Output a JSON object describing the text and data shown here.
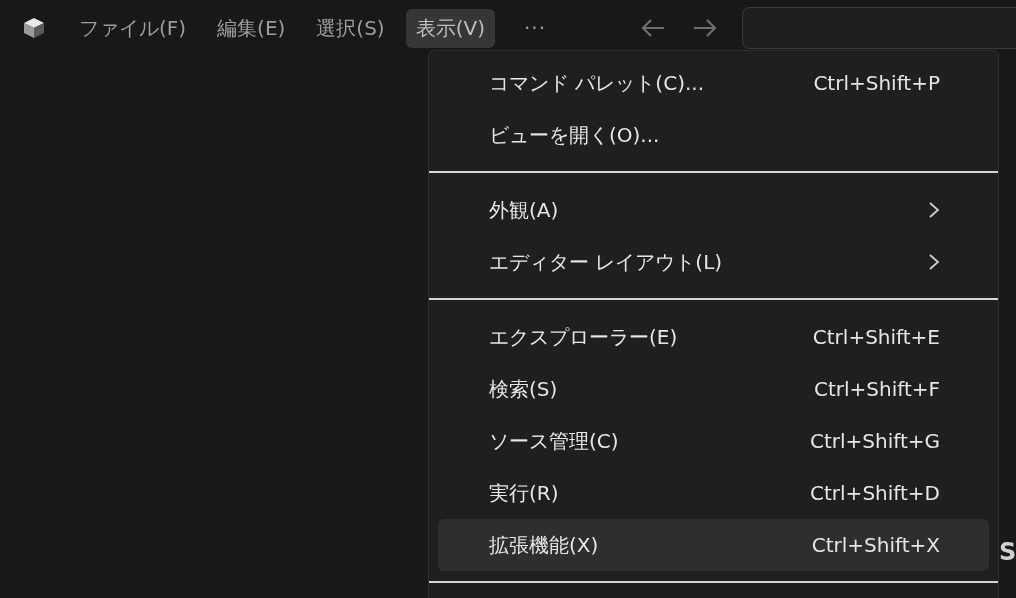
{
  "menu_bar": {
    "items": [
      {
        "label": "ファイル(F)",
        "selected": false
      },
      {
        "label": "編集(E)",
        "selected": false
      },
      {
        "label": "選択(S)",
        "selected": false
      },
      {
        "label": "表示(V)",
        "selected": true
      }
    ],
    "more": "···"
  },
  "menu": {
    "items": [
      {
        "kind": "item",
        "label": "コマンド パレット(C)...",
        "shortcut": "Ctrl+Shift+P",
        "selected": false
      },
      {
        "kind": "item",
        "label": "ビューを開く(O)...",
        "selected": false
      },
      {
        "kind": "separator"
      },
      {
        "kind": "submenu",
        "label": "外観(A)",
        "selected": false
      },
      {
        "kind": "submenu",
        "label": "エディター レイアウト(L)",
        "selected": false
      },
      {
        "kind": "separator"
      },
      {
        "kind": "item",
        "label": "エクスプローラー(E)",
        "shortcut": "Ctrl+Shift+E",
        "selected": false
      },
      {
        "kind": "item",
        "label": "検索(S)",
        "shortcut": "Ctrl+Shift+F",
        "selected": false
      },
      {
        "kind": "item",
        "label": "ソース管理(C)",
        "shortcut": "Ctrl+Shift+G",
        "selected": false
      },
      {
        "kind": "item",
        "label": "実行(R)",
        "shortcut": "Ctrl+Shift+D",
        "selected": false
      },
      {
        "kind": "item",
        "label": "拡張機能(X)",
        "shortcut": "Ctrl+Shift+X",
        "selected": true
      },
      {
        "kind": "separator"
      }
    ]
  },
  "background_text": "S"
}
